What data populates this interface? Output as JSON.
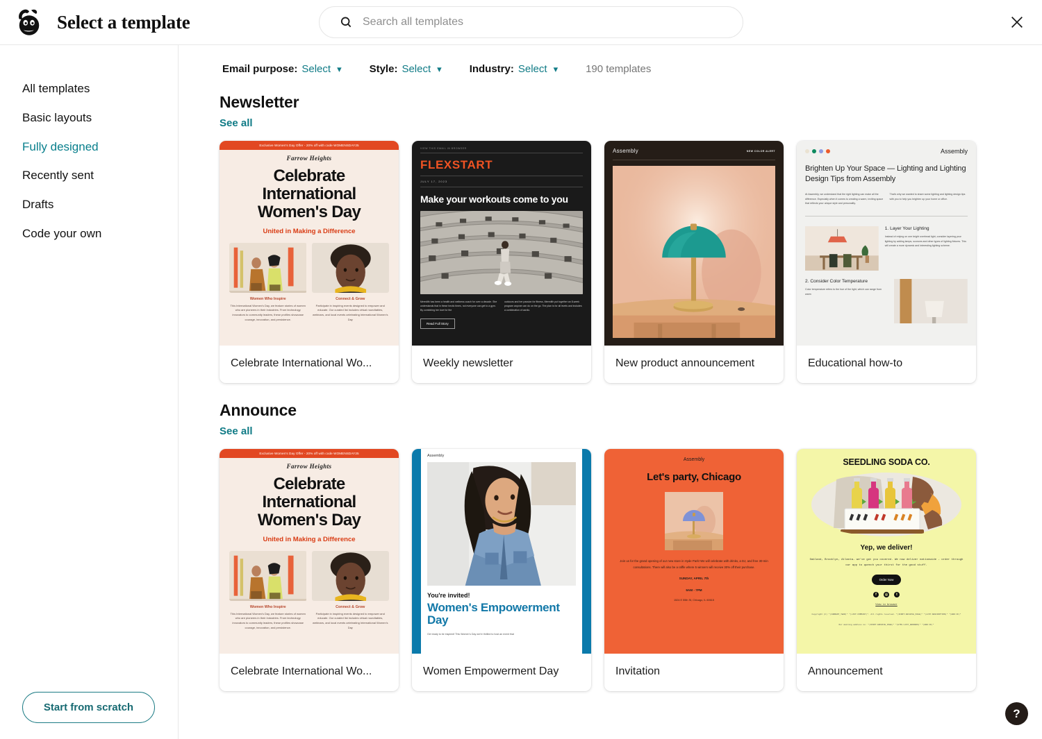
{
  "header": {
    "title": "Select a template",
    "logo_icon": "mailchimp-monkey-logo",
    "close_icon": "close-icon"
  },
  "search": {
    "placeholder": "Search all templates",
    "value": "",
    "icon": "search-icon"
  },
  "sidebar": {
    "items": [
      {
        "label": "All templates",
        "active": false
      },
      {
        "label": "Basic layouts",
        "active": false
      },
      {
        "label": "Fully designed",
        "active": true
      },
      {
        "label": "Recently sent",
        "active": false
      },
      {
        "label": "Drafts",
        "active": false
      },
      {
        "label": "Code your own",
        "active": false
      }
    ],
    "scratch_button": "Start from scratch"
  },
  "filters": [
    {
      "label": "Email purpose:",
      "value": "Select"
    },
    {
      "label": "Style:",
      "value": "Select"
    },
    {
      "label": "Industry:",
      "value": "Select"
    }
  ],
  "template_count": "190 templates",
  "help_button": "?",
  "colors": {
    "accent_teal": "#107b86",
    "text_dark": "#111111",
    "muted": "#767676"
  },
  "sections": [
    {
      "title": "Newsletter",
      "see_all": "See all",
      "cards": [
        {
          "label": "Celebrate International Wo...",
          "art": "iwd",
          "content": {
            "banner": "Exclusive Women's Day Offer - 20% off with code WOMENSDAY25",
            "brand": "Farrow Heights",
            "headline": "Celebrate International Women's Day",
            "subhead": "United in Making a Difference",
            "col1_title": "Women Who Inspire",
            "col1_body": "This International Women's Day, we feature stories of women who are pioneers in their industries. From technology innovators to community leaders, these profiles showcase courage, innovation, and persistence.",
            "col2_title": "Connect & Grow",
            "col2_body": "Participate in inspiring events designed to empower and educate. Our curated list includes virtual roundtables, webinars, and local events celebrating International Women's Day"
          }
        },
        {
          "label": "Weekly newsletter",
          "art": "flexstart",
          "content": {
            "eyebrow": "VIEW THIS EMAIL IN BROWSER",
            "logo": "FLEXSTART",
            "date": "JULY 17, 2023",
            "headline": "Make your workouts come to you",
            "col1": "Meredith has been a health and wellness coach for over a decade. She understands that in these hectic times, not everyone can get to a gym. By combining her love for the",
            "col2": "outdoors and her passion for fitness, Meredith put together an 8-week program anyone can do on the go. The plan is for all levels and includes a combination of cardio.",
            "button": "Read Full Story"
          }
        },
        {
          "label": "New product announcement",
          "art": "product",
          "content": {
            "brand": "Assembly",
            "badge": "NEW COLOR ALERT"
          }
        },
        {
          "label": "Educational how-to",
          "art": "edu",
          "content": {
            "brand": "Assembly",
            "dots": [
              "#eae2d2",
              "#0e8a5f",
              "#8f9be0",
              "#ec5b2b"
            ],
            "headline": "Brighten Up Your Space — Lighting and Lighting Design Tips from Assembly",
            "col1": "At Assembly, we understand that the right lighting can make all the difference. Especially when it comes to creating a warm, inviting space that reflects your unique style and personality.",
            "col2": "That's why we wanted to share some lighting and lighting design tips with you to help you brighten up your home or office.",
            "item1_title": "1. Layer Your Lighting",
            "item1_body": "Instead of relying on one bright overhead light, consider layering your lighting by adding lamps, sconces and other types of lighting fixtures. This will create a more dynamic and interesting lighting scheme.",
            "item2_title": "2. Consider Color Temperature",
            "item2_body": "Color temperature refers to the hue of the light, which can range from warm"
          }
        }
      ]
    },
    {
      "title": "Announce",
      "see_all": "See all",
      "cards": [
        {
          "label": "Celebrate International Wo...",
          "art": "iwd",
          "content": {
            "banner": "Exclusive Women's Day Offer - 20% off with code WOMENSDAY25",
            "brand": "Farrow Heights",
            "headline": "Celebrate International Women's Day",
            "subhead": "United in Making a Difference",
            "col1_title": "Women Who Inspire",
            "col1_body": "This International Women's Day, we feature stories of women who are pioneers in their industries. From technology innovators to community leaders, these profiles showcase courage, innovation, and persistence.",
            "col2_title": "Connect & Grow",
            "col2_body": "Participate in inspiring events designed to empower and educate. Our curated list includes virtual roundtables, webinars, and local events celebrating International Women's Day"
          }
        },
        {
          "label": "Women Empowerment Day",
          "art": "empower",
          "content": {
            "brand": "Assembly",
            "eyebrow": "You're invited!",
            "headline": "Women's Empowerment Day",
            "body": "Get ready to be inspired! This Women's Day we're thrilled to host an event that"
          }
        },
        {
          "label": "Invitation",
          "art": "invitation",
          "content": {
            "brand": "Assembly",
            "headline": "Let's party, Chicago",
            "body": "Join us for the grand opening of our new store in Hyde Park! We will celebrate with drinks, a DJ, and free 30-min consultations. There will also be a raffle where 5 winners will receive 30% off their purchase.",
            "date": "SUNDAY, APRIL 7th",
            "time": "9AM - 7PM",
            "address": "1524 E 55th St, Chicago, IL 60615"
          }
        },
        {
          "label": "Announcement",
          "art": "announcement",
          "content": {
            "logo": "SEEDLING SODA CO.",
            "headline": "Yep, we deliver!",
            "body": "Oakland, Brooklyn, Atlanta… we've got you covered. We now deliver nationwide - order through our app to quench your thirst for the good stuff.",
            "button": "Order Now",
            "social": [
              "f",
              "◎",
              "t"
            ],
            "link": "View in browser",
            "footer": "Copyright (C) *|CURRENT_YEAR|* *|LIST:COMPANY|*. All rights reserved. *|IFNOT:ARCHIVE_PAGE|* *|LIST:DESCRIPTION|* *|END:IF|*",
            "footer2": "Our mailing address is: *|IFNOT:ARCHIVE_PAGE|* *|HTML:LIST_ADDRESS|* *|END:IF|*"
          }
        }
      ]
    }
  ]
}
